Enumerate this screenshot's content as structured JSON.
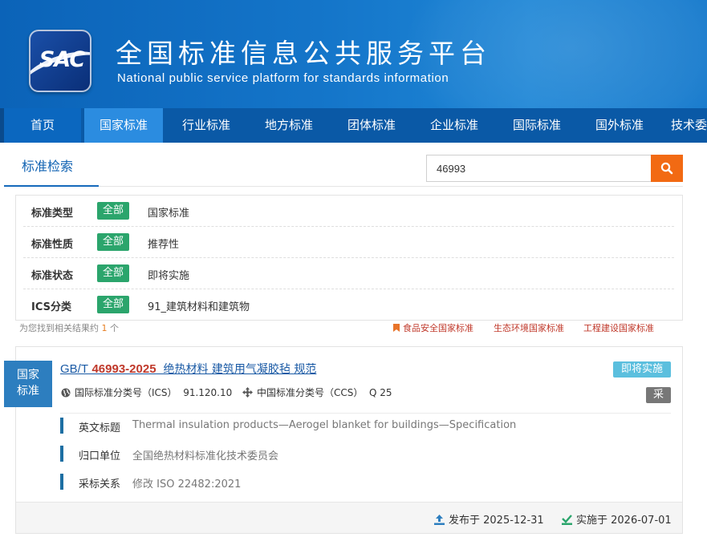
{
  "header": {
    "logo_text": "SAC",
    "title_cn": "全国标准信息公共服务平台",
    "title_en": "National public service platform  for standards information"
  },
  "nav": {
    "items": [
      "首页",
      "国家标准",
      "行业标准",
      "地方标准",
      "团体标准",
      "企业标准",
      "国际标准",
      "国外标准",
      "技术委"
    ],
    "active": "国家标准"
  },
  "search": {
    "tab_label": "标准检索",
    "query": "46993",
    "button_icon": "search-icon"
  },
  "filters": [
    {
      "name": "标准类型",
      "badge": "全部",
      "value": "国家标准"
    },
    {
      "name": "标准性质",
      "badge": "全部",
      "value": "推荐性"
    },
    {
      "name": "标准状态",
      "badge": "全部",
      "value": "即将实施"
    },
    {
      "name": "ICS分类",
      "badge": "全部",
      "value": "91_建筑材料和建筑物"
    }
  ],
  "results": {
    "count_prefix": "为您找到相关结果约",
    "count": "1",
    "count_suffix": "个",
    "quick_links": [
      "食品安全国家标准",
      "生态环境国家标准",
      "工程建设国家标准"
    ]
  },
  "card": {
    "category": [
      "国家",
      "标准"
    ],
    "code_prefix": "GB/T",
    "code_number": "46993-2025",
    "title": "绝热材料 建筑用气凝胶毡 规范",
    "status": "即将实施",
    "adopt_badge": "采",
    "ics_label": "国际标准分类号（ICS）",
    "ics_value": "91.120.10",
    "ccs_label": "中国标准分类号（CCS）",
    "ccs_value": "Q 25",
    "details": [
      {
        "key": "英文标题",
        "value": "Thermal insulation products—Aerogel blanket for buildings—Specification"
      },
      {
        "key": "归口单位",
        "value": "全国绝热材料标准化技术委员会"
      },
      {
        "key": "采标关系",
        "value": "修改  ISO 22482:2021"
      }
    ],
    "published": "发布于 2025-12-31",
    "effective": "实施于 2026-07-01"
  },
  "colors": {
    "banner": "#1475c9",
    "nav": "#0a59a6",
    "nav_active": "#2b8ce0",
    "badge_green": "#2ba56c",
    "search_button": "#f26a13",
    "status_blue": "#5bbfde"
  }
}
